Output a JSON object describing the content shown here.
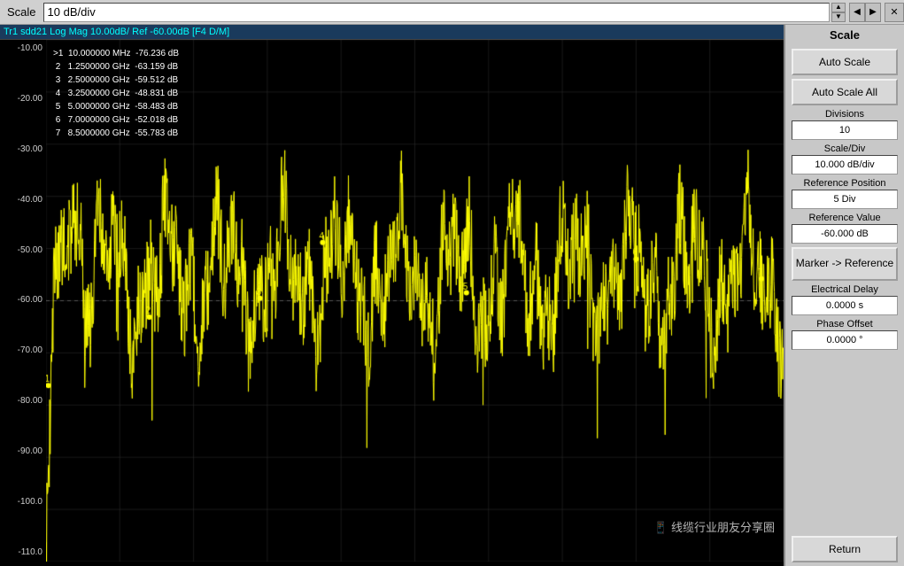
{
  "topbar": {
    "label": "Scale",
    "value": "10 dB/div",
    "panel_title": "Scale"
  },
  "chart": {
    "header": "Tr1  sdd21 Log Mag 10.00dB/ Ref -60.00dB [F4 D/M]",
    "y_labels": [
      "-10.00",
      "-20.00",
      "-30.00",
      "-40.00",
      "-50.00",
      "-60.00",
      "-70.00",
      "-80.00",
      "-90.00",
      "-100.0",
      "-110.0"
    ],
    "markers": [
      ">1  10.000000 MHz  -76.236 dB",
      "2   1.2500000 GHz  -63.159 dB",
      "3   2.5000000 GHz  -59.512 dB",
      "4   3.2500000 GHz  -48.831 dB",
      "5   5.0000000 GHz  -58.483 dB",
      "6   7.0000000 GHz  -52.018 dB",
      "7   8.5000000 GHz  -55.783 dB"
    ],
    "watermark": "线缆行业朋友分享圈"
  },
  "panel": {
    "title": "Scale",
    "auto_scale": "Auto Scale",
    "auto_scale_all": "Auto Scale All",
    "divisions_label": "Divisions",
    "divisions_value": "10",
    "scale_div_label": "Scale/Div",
    "scale_div_value": "10.000 dB/div",
    "ref_pos_label": "Reference Position",
    "ref_pos_value": "5 Div",
    "ref_val_label": "Reference Value",
    "ref_val_value": "-60.000 dB",
    "marker_ref_label": "Marker ->",
    "marker_ref_label2": "Reference",
    "elec_delay_label": "Electrical Delay",
    "elec_delay_value": "0.0000 s",
    "phase_offset_label": "Phase Offset",
    "phase_offset_value": "0.0000 °",
    "return_label": "Return"
  }
}
